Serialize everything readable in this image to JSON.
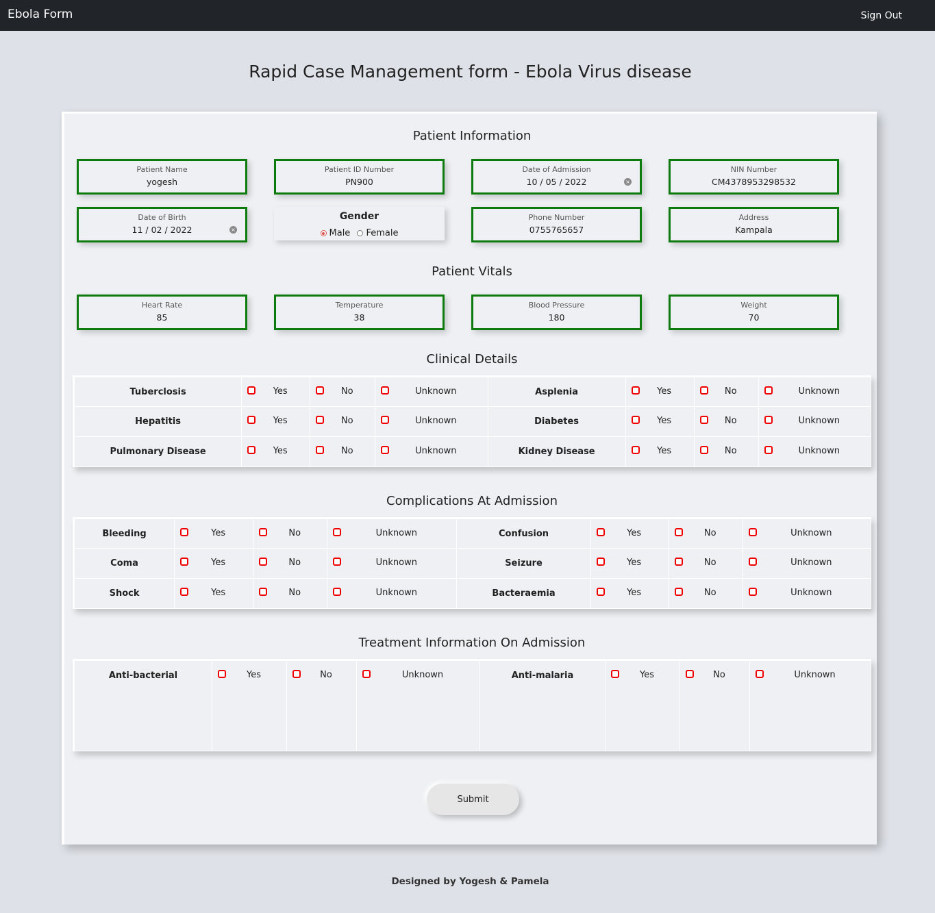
{
  "navbar": {
    "brand": "Ebola Form",
    "signout": "Sign Out"
  },
  "page_title": "Rapid Case Management form - Ebola Virus disease",
  "sections": {
    "patient_info": "Patient Information",
    "vitals": "Patient Vitals",
    "clinical": "Clinical Details",
    "complications": "Complications At Admission",
    "treatment": "Treatment Information On Admission"
  },
  "patient_fields": [
    {
      "label": "Patient Name",
      "value": "yogesh"
    },
    {
      "label": "Patient ID Number",
      "value": "PN900"
    },
    {
      "label": "Date of Admission",
      "value": "10 / 05 / 2022"
    },
    {
      "label": "NIN Number",
      "value": "CM4378953298532"
    },
    {
      "label": "Date of Birth",
      "value": "11 / 02 / 2022"
    },
    {
      "label": "Phone Number",
      "value": "0755765657"
    },
    {
      "label": "Address",
      "value": "Kampala"
    }
  ],
  "gender": {
    "title": "Gender",
    "male": "Male",
    "female": "Female",
    "selected": "Male"
  },
  "vitals": [
    {
      "label": "Heart Rate",
      "value": "85"
    },
    {
      "label": "Temperature",
      "value": "38"
    },
    {
      "label": "Blood Pressure",
      "value": "180"
    },
    {
      "label": "Weight",
      "value": "70"
    }
  ],
  "options": {
    "yes": "Yes",
    "no": "No",
    "unknown": "Unknown"
  },
  "clinical": [
    [
      "Tuberclosis",
      "Asplenia"
    ],
    [
      "Hepatitis",
      "Diabetes"
    ],
    [
      "Pulmonary Disease",
      "Kidney Disease"
    ]
  ],
  "complications": [
    [
      "Bleeding",
      "Confusion"
    ],
    [
      "Coma",
      "Seizure"
    ],
    [
      "Shock",
      "Bacteraemia"
    ]
  ],
  "treatment": [
    [
      "Anti-bacterial",
      "Anti-malaria"
    ]
  ],
  "submit_label": "Submit",
  "footer": "Designed by Yogesh & Pamela",
  "colors": {
    "navbar": "#212529",
    "field_border": "#0d7a0d",
    "checkbox": "#ee0000",
    "background": "#dee1e7"
  }
}
